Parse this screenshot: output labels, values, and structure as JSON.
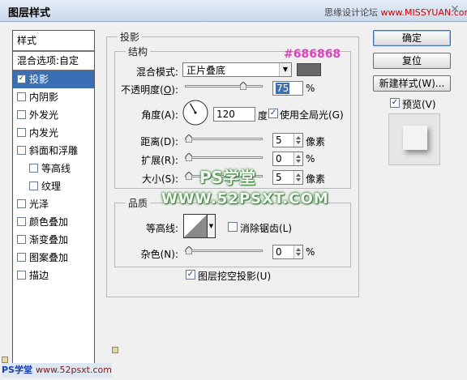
{
  "window": {
    "title": "图层样式",
    "close_glyph": "✕"
  },
  "watermark_top": {
    "text": "思缘设计论坛",
    "url": "www.MISSYUAN.com"
  },
  "left_panel": {
    "header": "样式",
    "blend_options": "混合选项:自定",
    "items": [
      {
        "label": "投影",
        "checked": true,
        "selected": true,
        "sub": false
      },
      {
        "label": "内阴影",
        "checked": false,
        "selected": false,
        "sub": false
      },
      {
        "label": "外发光",
        "checked": false,
        "selected": false,
        "sub": false
      },
      {
        "label": "内发光",
        "checked": false,
        "selected": false,
        "sub": false
      },
      {
        "label": "斜面和浮雕",
        "checked": false,
        "selected": false,
        "sub": false
      },
      {
        "label": "等高线",
        "checked": false,
        "selected": false,
        "sub": true
      },
      {
        "label": "纹理",
        "checked": false,
        "selected": false,
        "sub": true
      },
      {
        "label": "光泽",
        "checked": false,
        "selected": false,
        "sub": false
      },
      {
        "label": "颜色叠加",
        "checked": false,
        "selected": false,
        "sub": false
      },
      {
        "label": "渐变叠加",
        "checked": false,
        "selected": false,
        "sub": false
      },
      {
        "label": "图案叠加",
        "checked": false,
        "selected": false,
        "sub": false
      },
      {
        "label": "描边",
        "checked": false,
        "selected": false,
        "sub": false
      }
    ]
  },
  "drop_shadow": {
    "section_title": "投影",
    "structure_title": "结构",
    "blend_mode_label": "混合模式:",
    "blend_mode_value": "正片叠底",
    "shadow_color": "#686868",
    "opacity_label_pre": "不透明度(",
    "opacity_label_key": "O",
    "opacity_label_post": "):",
    "opacity_value": "75",
    "opacity_unit": "%",
    "opacity_level": 0.75,
    "angle_label": "角度(A):",
    "angle_value": "120",
    "angle_unit": "度",
    "global_light_label": "使用全局光(G)",
    "global_light_checked": true,
    "distance_label": "距离(D):",
    "distance_value": "5",
    "distance_unit": "像素",
    "spread_label": "扩展(R):",
    "spread_value": "0",
    "spread_unit": "%",
    "size_label": "大小(S):",
    "size_value": "5",
    "size_unit": "像素",
    "quality_title": "品质",
    "contour_label": "等高线:",
    "antialias_label": "消除锯齿(L)",
    "antialias_checked": false,
    "noise_label": "杂色(N):",
    "noise_value": "0",
    "noise_unit": "%",
    "knockout_label": "图层挖空投影(U)",
    "knockout_checked": true
  },
  "overlays": {
    "hex": "#686868",
    "ps": "PS学堂",
    "url": "WWW.52PSXT.COM"
  },
  "buttons": {
    "ok": "确定",
    "reset": "复位",
    "new_style": "新建样式(W)...",
    "preview_label": "预览(V)",
    "preview_checked": true
  },
  "watermark_bottom": {
    "ps": "PS学堂",
    "url": "www.52psxt.com"
  },
  "colors": {
    "selection": "#3a6fb6",
    "accent_pink": "#e040c0",
    "watermark_green": "#3a8a3a"
  }
}
